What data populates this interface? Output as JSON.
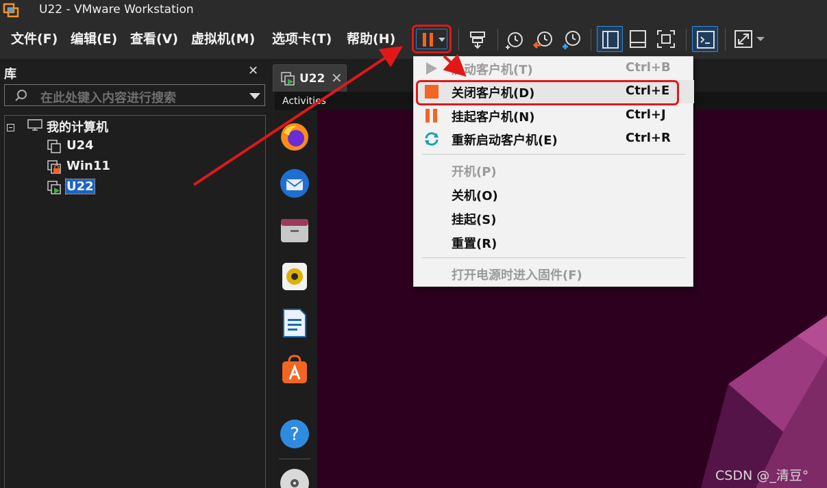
{
  "window": {
    "title": "U22 - VMware Workstation"
  },
  "menu": {
    "items": [
      {
        "label": "文件(F)"
      },
      {
        "label": "编辑(E)"
      },
      {
        "label": "查看(V)"
      },
      {
        "label": "虚拟机(M)"
      },
      {
        "label": "选项卡(T)"
      },
      {
        "label": "帮助(H)"
      }
    ]
  },
  "toolbar": {
    "icons": [
      "pause-icon",
      "dropdown-icon",
      "send-keys-icon",
      "snapshot-icon",
      "revert-snapshot-icon",
      "manage-snapshots-icon",
      "library-view-icon",
      "thumbnail-bar-icon",
      "fullscreen-icon",
      "console-view-icon",
      "stretch-icon"
    ]
  },
  "library": {
    "title": "库",
    "close": "✕",
    "search": {
      "placeholder": "在此处键入内容进行搜索"
    },
    "tree": {
      "root": "我的计算机",
      "items": [
        {
          "label": "U24",
          "status": "off"
        },
        {
          "label": "Win11",
          "status": "locked"
        },
        {
          "label": "U22",
          "status": "running",
          "selected": true
        }
      ]
    }
  },
  "tabs": [
    {
      "label": "U22",
      "close": "✕"
    }
  ],
  "guest": {
    "activities": "Activities",
    "dock_icons": [
      "firefox-icon",
      "thunderbird-icon",
      "files-icon",
      "rhythmbox-icon",
      "libreoffice-writer-icon",
      "app-center-icon",
      "help-icon",
      "disc-icon"
    ]
  },
  "power_menu": {
    "items": [
      {
        "label": "启动客户机(T)",
        "shortcut": "Ctrl+B",
        "enabled": false
      },
      {
        "label": "关闭客户机(D)",
        "shortcut": "Ctrl+E",
        "enabled": true,
        "highlighted": true
      },
      {
        "label": "挂起客户机(N)",
        "shortcut": "Ctrl+J",
        "enabled": true
      },
      {
        "label": "重新启动客户机(E)",
        "shortcut": "Ctrl+R",
        "enabled": true
      },
      {
        "label": "开机(P)",
        "shortcut": "",
        "enabled": false
      },
      {
        "label": "关机(O)",
        "shortcut": "",
        "enabled": true
      },
      {
        "label": "挂起(S)",
        "shortcut": "",
        "enabled": true
      },
      {
        "label": "重置(R)",
        "shortcut": "",
        "enabled": true
      },
      {
        "label": "打开电源时进入固件(F)",
        "shortcut": "",
        "enabled": false
      }
    ]
  },
  "colors": {
    "accent_orange": "#f26522",
    "annotation_red": "#e21818",
    "selection_blue": "#1a64c8",
    "wallpaper": "#2c001e"
  },
  "watermark": "CSDN @_清豆°"
}
